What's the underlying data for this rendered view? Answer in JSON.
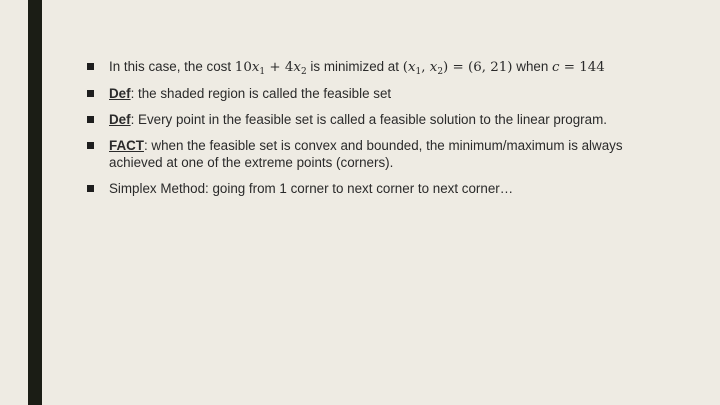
{
  "slide": {
    "bullets": [
      {
        "prefix": "In this case, the cost ",
        "cost_expr": {
          "c1": "10",
          "v1": "x",
          "s1": "1",
          "op": " + ",
          "c2": "4",
          "v2": "x",
          "s2": "2"
        },
        "mid": " is minimized at ",
        "point_expr": {
          "open": "(",
          "v1": "x",
          "s1": "1",
          "comma": ", ",
          "v2": "x",
          "s2": "2",
          "close": ")",
          "eq": " = ",
          "value": "(6, 21)"
        },
        "when": " when ",
        "c_expr": {
          "var": "c",
          "eq": " = ",
          "value": "144"
        }
      },
      {
        "term": "Def",
        "text": ": the shaded region is called the feasible set"
      },
      {
        "term": "Def",
        "text": ": Every point in the feasible set is called a feasible solution to the linear program."
      },
      {
        "term": "FACT",
        "text": ": when the feasible set is convex and bounded, the minimum/maximum is always achieved at one of the extreme points (corners)."
      },
      {
        "text": "Simplex Method: going from 1 corner to next corner to next corner…"
      }
    ]
  },
  "colors": {
    "background": "#eeebe3",
    "accent_bar": "#1b1d15",
    "text": "#2a2a2a"
  }
}
